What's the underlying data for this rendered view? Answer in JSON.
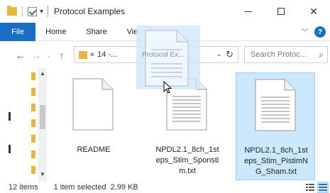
{
  "window": {
    "title": "Protocol Examples"
  },
  "ribbon": {
    "tabs": [
      "File",
      "Home",
      "Share",
      "Vie"
    ]
  },
  "address": {
    "crumb_prefix": "«",
    "crumb": "14 -...",
    "search_placeholder": "Search Protoc..."
  },
  "files": [
    {
      "name": "README",
      "selected": false
    },
    {
      "name": "NPDL2.1_8ch_1steps_Stim_Sponstim.txt",
      "display": "NPDL2.1_8ch_1st eps_Stim_Sponsti m.txt",
      "selected": false
    },
    {
      "name": "NPDL2.1_8ch_1steps_Stim_PistimNG_Sham.txt",
      "display": "NPDL2.1_8ch_1st eps_Stim_PistimN G_Sham.txt",
      "selected": true
    }
  ],
  "drag_ghost": {
    "label": "Protocol Ex..."
  },
  "status": {
    "item_count": "12 items",
    "selected": "1 item selected",
    "size": "2.99 KB"
  },
  "colors": {
    "accent": "#1a6fc4",
    "selection_bg": "#cce8ff",
    "selection_border": "#99d1ff",
    "folder": "#e8b640"
  }
}
